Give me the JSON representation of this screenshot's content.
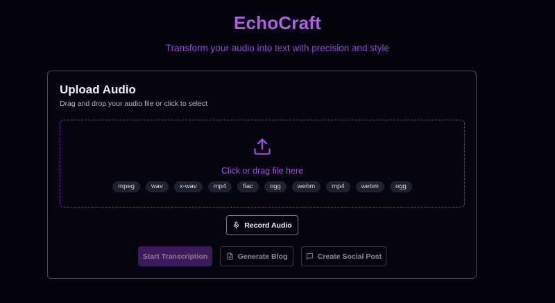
{
  "header": {
    "title": "EchoCraft",
    "subtitle": "Transform your audio into text with precision and style"
  },
  "upload_card": {
    "title": "Upload Audio",
    "description": "Drag and drop your audio file or click to select",
    "dropzone": {
      "icon": "upload-icon",
      "prompt": "Click or drag file here",
      "formats": [
        "mpeg",
        "wav",
        "x-wav",
        "mp4",
        "flac",
        "ogg",
        "webm",
        "mp4",
        "webm",
        "ogg"
      ]
    }
  },
  "actions": {
    "record": {
      "label": "Record Audio",
      "icon": "microphone-icon"
    },
    "start_transcription": {
      "label": "Start Transcription",
      "disabled": true
    },
    "generate_blog": {
      "label": "Generate Blog",
      "icon": "document-icon",
      "disabled": true
    },
    "create_social_post": {
      "label": "Create Social Post",
      "icon": "chat-bubble-icon",
      "disabled": true
    }
  },
  "colors": {
    "background": "#03030e",
    "accent": "#b25ee6",
    "dropzone_border": "#7a2fb8",
    "primary_disabled": "#3b1b5a"
  }
}
